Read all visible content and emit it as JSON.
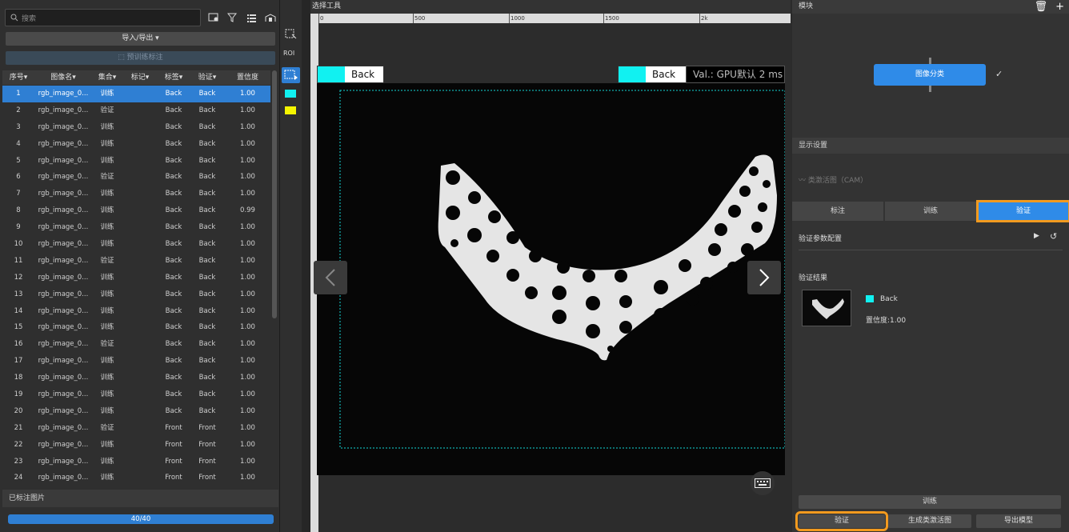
{
  "left": {
    "search_placeholder": "搜索",
    "import_export": "导入/导出 ▾",
    "pretrain": "预训练标注",
    "columns": [
      "序号",
      "图像名",
      "集合",
      "标记",
      "标签",
      "验证",
      "置信度"
    ],
    "rows": [
      {
        "n": "1",
        "name": "rgb_image_0...",
        "set": "训练",
        "mark": "",
        "label": "Back",
        "val": "Back",
        "conf": "1.00"
      },
      {
        "n": "2",
        "name": "rgb_image_0...",
        "set": "验证",
        "mark": "",
        "label": "Back",
        "val": "Back",
        "conf": "1.00"
      },
      {
        "n": "3",
        "name": "rgb_image_0...",
        "set": "训练",
        "mark": "",
        "label": "Back",
        "val": "Back",
        "conf": "1.00"
      },
      {
        "n": "4",
        "name": "rgb_image_0...",
        "set": "训练",
        "mark": "",
        "label": "Back",
        "val": "Back",
        "conf": "1.00"
      },
      {
        "n": "5",
        "name": "rgb_image_0...",
        "set": "训练",
        "mark": "",
        "label": "Back",
        "val": "Back",
        "conf": "1.00"
      },
      {
        "n": "6",
        "name": "rgb_image_0...",
        "set": "验证",
        "mark": "",
        "label": "Back",
        "val": "Back",
        "conf": "1.00"
      },
      {
        "n": "7",
        "name": "rgb_image_0...",
        "set": "训练",
        "mark": "",
        "label": "Back",
        "val": "Back",
        "conf": "1.00"
      },
      {
        "n": "8",
        "name": "rgb_image_0...",
        "set": "训练",
        "mark": "",
        "label": "Back",
        "val": "Back",
        "conf": "0.99"
      },
      {
        "n": "9",
        "name": "rgb_image_0...",
        "set": "训练",
        "mark": "",
        "label": "Back",
        "val": "Back",
        "conf": "1.00"
      },
      {
        "n": "10",
        "name": "rgb_image_0...",
        "set": "训练",
        "mark": "",
        "label": "Back",
        "val": "Back",
        "conf": "1.00"
      },
      {
        "n": "11",
        "name": "rgb_image_0...",
        "set": "验证",
        "mark": "",
        "label": "Back",
        "val": "Back",
        "conf": "1.00"
      },
      {
        "n": "12",
        "name": "rgb_image_0...",
        "set": "训练",
        "mark": "",
        "label": "Back",
        "val": "Back",
        "conf": "1.00"
      },
      {
        "n": "13",
        "name": "rgb_image_0...",
        "set": "训练",
        "mark": "",
        "label": "Back",
        "val": "Back",
        "conf": "1.00"
      },
      {
        "n": "14",
        "name": "rgb_image_0...",
        "set": "训练",
        "mark": "",
        "label": "Back",
        "val": "Back",
        "conf": "1.00"
      },
      {
        "n": "15",
        "name": "rgb_image_0...",
        "set": "训练",
        "mark": "",
        "label": "Back",
        "val": "Back",
        "conf": "1.00"
      },
      {
        "n": "16",
        "name": "rgb_image_0...",
        "set": "验证",
        "mark": "",
        "label": "Back",
        "val": "Back",
        "conf": "1.00"
      },
      {
        "n": "17",
        "name": "rgb_image_0...",
        "set": "训练",
        "mark": "",
        "label": "Back",
        "val": "Back",
        "conf": "1.00"
      },
      {
        "n": "18",
        "name": "rgb_image_0...",
        "set": "训练",
        "mark": "",
        "label": "Back",
        "val": "Back",
        "conf": "1.00"
      },
      {
        "n": "19",
        "name": "rgb_image_0...",
        "set": "训练",
        "mark": "",
        "label": "Back",
        "val": "Back",
        "conf": "1.00"
      },
      {
        "n": "20",
        "name": "rgb_image_0...",
        "set": "训练",
        "mark": "",
        "label": "Back",
        "val": "Back",
        "conf": "1.00"
      },
      {
        "n": "21",
        "name": "rgb_image_0...",
        "set": "验证",
        "mark": "",
        "label": "Front",
        "val": "Front",
        "conf": "1.00"
      },
      {
        "n": "22",
        "name": "rgb_image_0...",
        "set": "训练",
        "mark": "",
        "label": "Front",
        "val": "Front",
        "conf": "1.00"
      },
      {
        "n": "23",
        "name": "rgb_image_0...",
        "set": "训练",
        "mark": "",
        "label": "Front",
        "val": "Front",
        "conf": "1.00"
      },
      {
        "n": "24",
        "name": "rgb_image_0...",
        "set": "训练",
        "mark": "",
        "label": "Front",
        "val": "Front",
        "conf": "1.00"
      }
    ],
    "labeled_images": "已标注图片",
    "progress_text": "40/40",
    "progress_fraction": 1.0
  },
  "strip": {
    "roi": "ROI"
  },
  "center": {
    "title": "选择工具",
    "ruler_ticks": [
      "0",
      "500",
      "1000",
      "1500",
      "2k"
    ],
    "label_left": "Back",
    "label_right": "Back",
    "val_info": "Val.: GPU默认 2 ms"
  },
  "right": {
    "module_title": "模块",
    "node_label": "图像分类",
    "display_settings": "显示设置",
    "cam_label": "类激活图（CAM）",
    "tabs": [
      "标注",
      "训练",
      "验证"
    ],
    "val_params": "验证参数配置",
    "val_results": "验证结果",
    "result_label": "Back",
    "confidence": "置信度:1.00",
    "btn_train": "训练",
    "btn_validate": "验证",
    "btn_cam": "生成类激活图",
    "btn_export": "导出模型"
  },
  "colors": {
    "accent": "#2f8be8",
    "highlight": "#f29a1f",
    "cyan": "#11f1f1",
    "yellow": "#f5f500"
  }
}
